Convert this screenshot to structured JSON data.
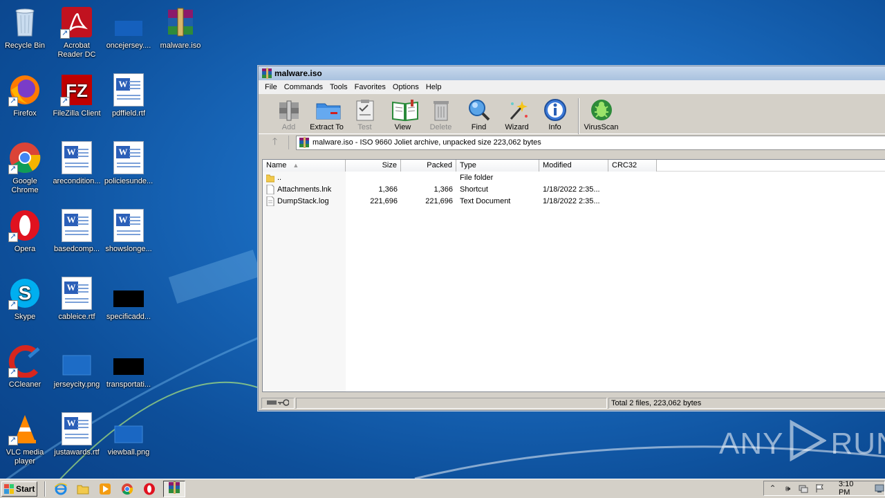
{
  "desktop": {
    "icons": [
      {
        "label": "Recycle Bin"
      },
      {
        "label": "Acrobat Reader DC"
      },
      {
        "label": "oncejersey...."
      },
      {
        "label": "malware.iso"
      },
      {
        "label": "Firefox"
      },
      {
        "label": "FileZilla Client"
      },
      {
        "label": "pdffield.rtf"
      },
      {
        "label": "Google Chrome"
      },
      {
        "label": "arecondition..."
      },
      {
        "label": "policiesunde..."
      },
      {
        "label": "Opera"
      },
      {
        "label": "basedcomp..."
      },
      {
        "label": "showslonge..."
      },
      {
        "label": "Skype"
      },
      {
        "label": "cableice.rtf"
      },
      {
        "label": "specificadd..."
      },
      {
        "label": "CCleaner"
      },
      {
        "label": "jerseycity.png"
      },
      {
        "label": "transportati..."
      },
      {
        "label": "VLC media player"
      },
      {
        "label": "justawards.rtf"
      },
      {
        "label": "viewball.png"
      }
    ]
  },
  "window": {
    "title": "malware.iso",
    "menu": [
      "File",
      "Commands",
      "Tools",
      "Favorites",
      "Options",
      "Help"
    ],
    "toolbar": [
      {
        "label": "Add",
        "icon": "add-archive-icon",
        "enabled": false
      },
      {
        "label": "Extract To",
        "icon": "extract-folder-icon",
        "enabled": true
      },
      {
        "label": "Test",
        "icon": "test-clipboard-icon",
        "enabled": false
      },
      {
        "label": "View",
        "icon": "view-book-icon",
        "enabled": true
      },
      {
        "label": "Delete",
        "icon": "trash-icon",
        "enabled": false
      },
      {
        "label": "Find",
        "icon": "magnifier-icon",
        "enabled": true
      },
      {
        "label": "Wizard",
        "icon": "wand-icon",
        "enabled": true
      },
      {
        "label": "Info",
        "icon": "info-icon",
        "enabled": true
      },
      {
        "label": "VirusScan",
        "icon": "bug-icon",
        "enabled": true
      }
    ],
    "address": "malware.iso - ISO 9660 Joliet archive, unpacked size 223,062 bytes",
    "columns": {
      "name": "Name",
      "size": "Size",
      "packed": "Packed",
      "type": "Type",
      "modified": "Modified",
      "crc": "CRC32"
    },
    "rows": [
      {
        "name": "..",
        "size": "",
        "packed": "",
        "type": "File folder",
        "modified": "",
        "icon": "folder-icon"
      },
      {
        "name": "Attachments.lnk",
        "size": "1,366",
        "packed": "1,366",
        "type": "Shortcut",
        "modified": "1/18/2022 2:35...",
        "icon": "file-icon"
      },
      {
        "name": "DumpStack.log",
        "size": "221,696",
        "packed": "221,696",
        "type": "Text Document",
        "modified": "1/18/2022 2:35...",
        "icon": "file-icon"
      }
    ],
    "status": "Total 2 files, 223,062 bytes"
  },
  "watermark": {
    "left": "ANY",
    "right": "RUN"
  },
  "taskbar": {
    "start_label": "Start",
    "clock": "3:10 PM"
  },
  "colors": {
    "desktop_blue": "#1a6bbf",
    "window_face": "#d4d0c8"
  }
}
